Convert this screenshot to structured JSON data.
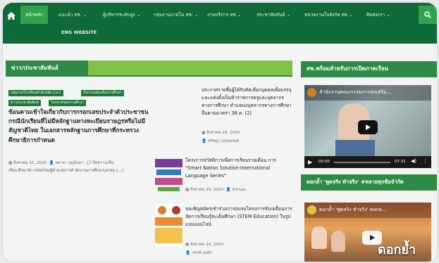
{
  "nav": {
    "home_icon": "home-icon",
    "items": [
      {
        "label": "หน้าหลัก"
      },
      {
        "label": "แนะนำ สช. ⌄"
      },
      {
        "label": "ผู้บริหารระดับสูง ⌄"
      },
      {
        "label": "กลุ่มงานภายใน สช. ⌄"
      },
      {
        "label": "งานบริการ สช ⌄"
      },
      {
        "label": "ประชาสัมพันธ์ ⌄"
      },
      {
        "label": "หน่วยงานในสังกัด ศธ ⌄"
      },
      {
        "label": "ติดต่อเรา ⌄"
      }
    ],
    "eng_label": "ENG WEBSITE",
    "search_icon": "search-icon"
  },
  "news": {
    "heading": "ข่าว/ประชาสัมพันธ์",
    "tags": [
      "กลุ่มงานโรงเรียนสำนักปลัด (กล.)",
      "กิจกรรมส่งเสริมการศึกษา",
      "ข่าวประชาสัมพันธ์",
      "ไตรมาสของงานศึกษา"
    ],
    "main_title": "ข้อนคามเข้าใจเกี่ยวกับการกรอกเลขประจำตัวประชาชน กรณีนักเรียนที่ไม่มีหลักฐานทางทะเบียนราษฎรหรือไม่มีสัญชาติไทย ในเอกสารหลักฐานการศึกษาที่กระทรวงศึกษาธิการกำหนด",
    "main_date": "สิงหาคม 31, 2020",
    "main_author": "พยายา บุญจินดา",
    "main_comment": "ปิดความเห็น",
    "main_excerpt": "เรียน ศึกษาธิการจังหวัด/ผู้อำนวยการสำนักงานการศึกษาเอกชน [...]",
    "side": [
      {
        "title": "ประกาศรายชื่อผู้ได้รับคัดเลือกบุคคลเพื่อบรรจุและแต่งตั้งเป็นข้าราชการครูและบุคลากรทางการศึกษา ตำแหน่งบุคลากรทางการศึกษาอื่นตามมาตรา 38 ค. (2)",
        "date": "สิงหาคม 28, 2020",
        "author": "ปรัชญา แสนพลอย"
      },
      {
        "title": "โครงการสวัสดิการเพื่อการเรียนรายเดือน การ \"Smart Nation Solution-International Language Series\"",
        "date": "สิงหาคม 25, 2020",
        "author": "Sirinya"
      },
      {
        "title": "ขอเชิญสมัครเข้าร่วมการอบรมโครงการขับเคลื่อนการจัดการเรียนรู้สะเต็มศึกษา (STEM Education) ในรูปแบบออนไลน์",
        "date": "สิงหาคม 24, 2020",
        "author": "วรรณี อุปถัง"
      }
    ]
  },
  "right": {
    "heading1": "สช.พร้อมสำหรับการเปิดภาคเรียน",
    "video1_title": "สำนักงานคณะกรรมการส่งเสริม...",
    "video1_time_start": "00:00",
    "video1_time_end": "07:31",
    "heading2": "ดอกย้ำ 'พูดจริง ทำจริง' #ทลายทุกข้อจำกัด",
    "video2_title": "ดอกย้ำ 'พูดจริง ทำจริง' ดอกย...",
    "video2_overlay": "ดอกย้ำ"
  },
  "colors": {
    "nav_bg": "#0f6a3a",
    "accent": "#33a24f",
    "section_head": "#2e8b46",
    "section_tail": "#7fc248"
  }
}
